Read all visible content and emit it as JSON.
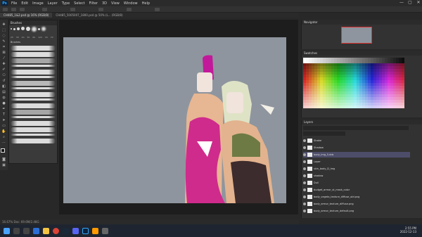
{
  "menubar": {
    "logo": "Ps",
    "items": [
      "File",
      "Edit",
      "Image",
      "Layer",
      "Type",
      "Select",
      "Filter",
      "3D",
      "View",
      "Window",
      "Help"
    ],
    "window_controls": [
      "—",
      "▢",
      "✕"
    ]
  },
  "tabs": [
    {
      "label": "CH485_1&2.psd @ 16% (RGB/8)",
      "active": true
    },
    {
      "label": "CH485_5005007_1800.psd @ 50% (L... (RGB/8)",
      "active": false
    }
  ],
  "brushes_panel": {
    "title": "Brushes",
    "tip_sizes": [
      "25",
      "30",
      "40",
      "50",
      "60",
      "120",
      "16",
      "70"
    ],
    "group_label": "Brushes"
  },
  "navigator_title": "Navigator",
  "swatches_title": "Swatches",
  "layers": {
    "title": "Layers",
    "rows": [
      {
        "label": "Stroke",
        "selected": false
      },
      {
        "label": "Shadow",
        "selected": false
      },
      {
        "label": "body_img_5.dds",
        "selected": true
      },
      {
        "label": "Layer",
        "selected": false
      },
      {
        "label": "skin_body_D_img",
        "selected": false
      },
      {
        "label": "shadow",
        "selected": false
      },
      {
        "label": "Dull",
        "selected": false
      },
      {
        "label": "budget_armor_st_mask_color",
        "selected": false
      },
      {
        "label": "body_vegeta_texture_diffuse_old.png",
        "selected": false
      },
      {
        "label": "body_armor_texture_diffuse.png",
        "selected": false
      },
      {
        "label": "body_armor_texture_default.png",
        "selected": false
      }
    ]
  },
  "status": "16.67%   Doc: 69.6M/2.48G",
  "taskbar": {
    "time": "2:55 PM",
    "date": "2022-12-13"
  },
  "colors": {
    "accent": "#31a8ff",
    "artboard": "#8e959e"
  }
}
